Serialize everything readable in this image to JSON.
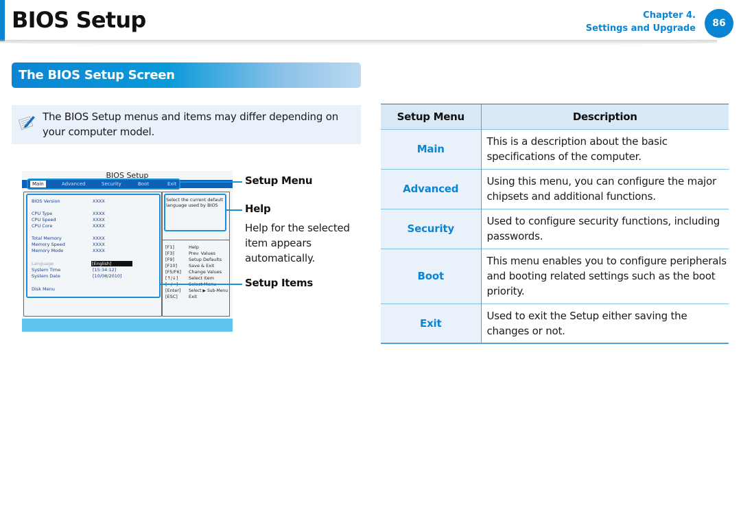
{
  "header": {
    "title": "BIOS Setup",
    "chapter_line1": "Chapter 4.",
    "chapter_line2": "Settings and Upgrade",
    "page_number": "86"
  },
  "section": {
    "heading": "The BIOS Setup Screen"
  },
  "note": {
    "icon": "note-pencil-icon",
    "line1": "The BIOS Setup menus and items may differ depending on",
    "line2": "your computer model."
  },
  "bios_screen": {
    "title": "BIOS Setup",
    "menus": [
      {
        "label": "Main",
        "active": true
      },
      {
        "label": "Advanced",
        "active": false
      },
      {
        "label": "Security",
        "active": false
      },
      {
        "label": "Boot",
        "active": false
      },
      {
        "label": "Exit",
        "active": false
      }
    ],
    "items": [
      {
        "label": "BIOS Version",
        "value": "XXXX"
      },
      {
        "label": "CPU Type",
        "value": "XXXX"
      },
      {
        "label": "CPU Speed",
        "value": "XXXX"
      },
      {
        "label": "CPU Core",
        "value": "XXXX"
      },
      {
        "label": "Total Memory",
        "value": "XXXX"
      },
      {
        "label": "Memory Speed",
        "value": "XXXX"
      },
      {
        "label": "Memory Mode",
        "value": "XXXX"
      },
      {
        "label": "Language",
        "value": "[English]",
        "selected": true
      },
      {
        "label": "System Time",
        "value": "[15:34:12]"
      },
      {
        "label": "System Date",
        "value": "[10/08/2010]"
      },
      {
        "label": "Disk Menu",
        "value": ""
      }
    ],
    "help_text": "Select the current default language used by BIOS",
    "keys": [
      {
        "key": "[F1]",
        "desc": "Help"
      },
      {
        "key": "[F3]",
        "desc": "Prev. Values"
      },
      {
        "key": "[F9]",
        "desc": "Setup Defaults"
      },
      {
        "key": "[F10]",
        "desc": "Save & Exit"
      },
      {
        "key": "[F5/F6]",
        "desc": "Change Values"
      },
      {
        "key": "[↑/↓]",
        "desc": "Select Item"
      },
      {
        "key": "[←/→]",
        "desc": "Select Menu"
      },
      {
        "key": "[Enter]",
        "desc": "Select ▶ Sub-Menu"
      },
      {
        "key": "[ESC]",
        "desc": "Exit"
      }
    ]
  },
  "callouts": {
    "setup_menu": "Setup Menu",
    "help": "Help",
    "help_desc_1": "Help for the selected",
    "help_desc_2": "item appears",
    "help_desc_3": "automatically.",
    "setup_items": "Setup Items"
  },
  "table": {
    "headers": [
      "Setup Menu",
      "Description"
    ],
    "rows": [
      {
        "menu": "Main",
        "desc": "This is a description about the basic specifications of the computer."
      },
      {
        "menu": "Advanced",
        "desc": "Using this menu, you can configure the major chipsets and additional functions."
      },
      {
        "menu": "Security",
        "desc": "Used to configure security functions, including passwords."
      },
      {
        "menu": "Boot",
        "desc": "This menu enables you to configure peripherals and booting related settings such as the boot priority."
      },
      {
        "menu": "Exit",
        "desc": "Used to exit the Setup either saving the changes or not."
      }
    ]
  },
  "colors": {
    "accent": "#0a85d4",
    "note_bg": "#e9f2fb",
    "table_header_bg": "#d8e8f5"
  }
}
